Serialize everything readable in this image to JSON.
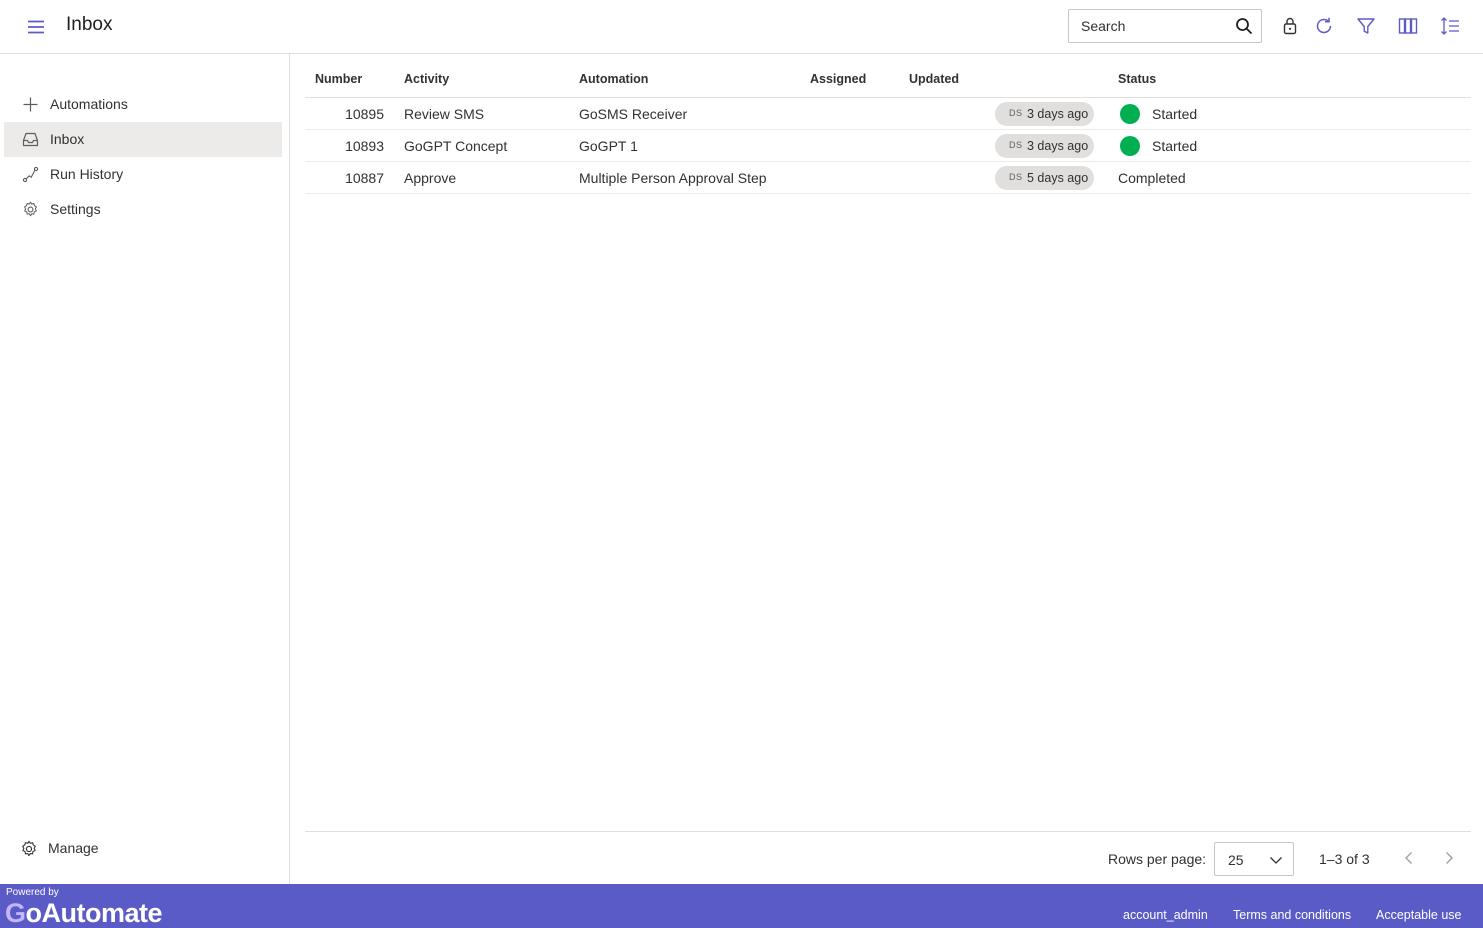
{
  "header": {
    "title": "Inbox",
    "search_placeholder": "Search",
    "toolbar_icons": [
      "lock-icon",
      "refresh-icon",
      "filter-icon",
      "columns-icon",
      "sort-icon"
    ]
  },
  "sidebar": {
    "items": [
      {
        "label": "Automations",
        "icon": "plus-icon",
        "active": false
      },
      {
        "label": "Inbox",
        "icon": "inbox-icon",
        "active": true
      },
      {
        "label": "Run History",
        "icon": "run-history-icon",
        "active": false
      },
      {
        "label": "Settings",
        "icon": "gear-icon",
        "active": false
      }
    ],
    "manage_label": "Manage"
  },
  "table": {
    "columns": [
      "Number",
      "Activity",
      "Automation",
      "Assigned",
      "Updated",
      "Status"
    ],
    "rows": [
      {
        "number": "10895",
        "activity": "Review SMS",
        "automation": "GoSMS Receiver",
        "assigned": "",
        "user_initials": "DS",
        "updated": "3 days ago",
        "status": "Started",
        "status_dot": true
      },
      {
        "number": "10893",
        "activity": "GoGPT Concept",
        "automation": "GoGPT 1",
        "assigned": "",
        "user_initials": "DS",
        "updated": "3 days ago",
        "status": "Started",
        "status_dot": true
      },
      {
        "number": "10887",
        "activity": "Approve",
        "automation": "Multiple Person Approval Step",
        "assigned": "",
        "user_initials": "DS",
        "updated": "5 days ago",
        "status": "Completed",
        "status_dot": false
      }
    ]
  },
  "pagination": {
    "rows_per_page_label": "Rows per page:",
    "rows_per_page": "25",
    "range": "1–3 of 3"
  },
  "footer": {
    "powered_by": "Powered by",
    "logo_g": "G",
    "logo_rest": "oAutomate",
    "links": [
      "account_admin",
      "Terms and conditions",
      "Acceptable use"
    ]
  },
  "colors": {
    "accent": "#5b5bc7",
    "status_started": "#00b050",
    "active_nav": "#edebe9"
  }
}
